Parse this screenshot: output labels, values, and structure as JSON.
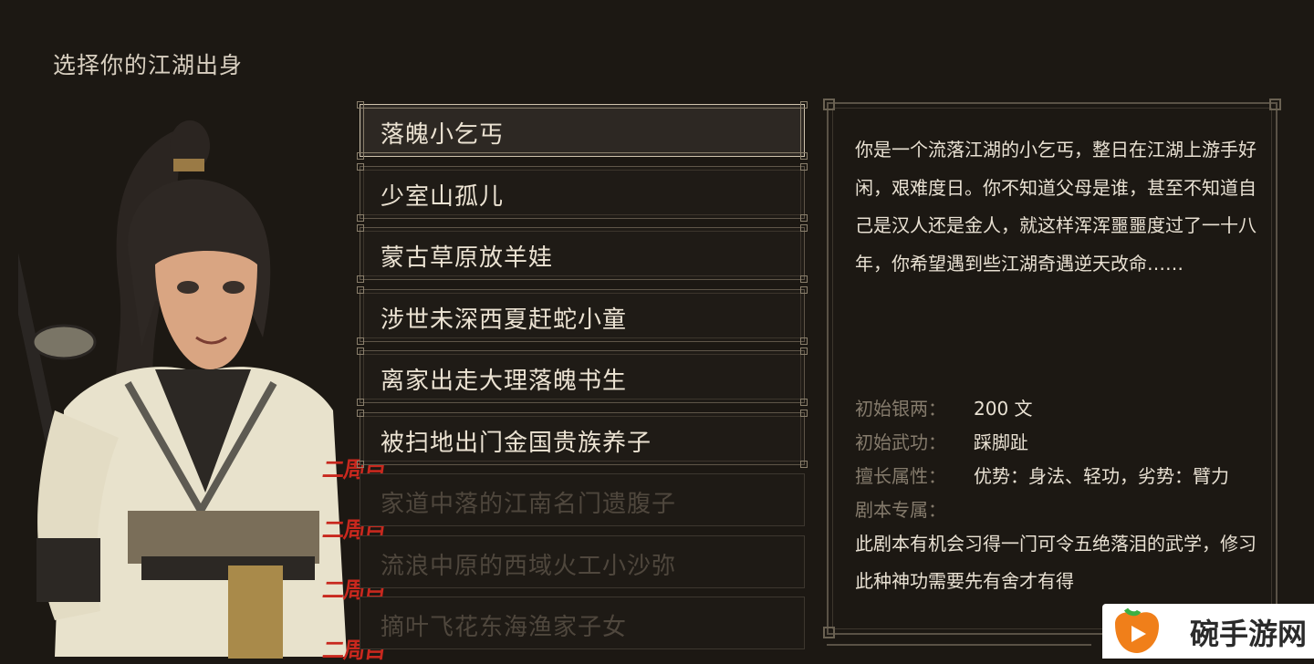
{
  "header": {
    "title": "选择你的江湖出身"
  },
  "origins": [
    {
      "label": "落魄小乞丐",
      "state": "selected"
    },
    {
      "label": "少室山孤儿",
      "state": "normal"
    },
    {
      "label": "蒙古草原放羊娃",
      "state": "normal"
    },
    {
      "label": "涉世未深西夏赶蛇小童",
      "state": "normal"
    },
    {
      "label": "离家出走大理落魄书生",
      "state": "normal"
    },
    {
      "label": "被扫地出门金国贵族养子",
      "state": "normal"
    },
    {
      "label": "家道中落的江南名门遗腹子",
      "state": "locked"
    },
    {
      "label": "流浪中原的西域火工小沙弥",
      "state": "locked"
    },
    {
      "label": "摘叶飞花东海渔家子女",
      "state": "locked"
    }
  ],
  "badges": {
    "second_run": "二周目"
  },
  "detail": {
    "description": "你是一个流落江湖的小乞丐，整日在江湖上游手好闲，艰难度日。你不知道父母是谁，甚至不知道自己是汉人还是金人，就这样浑浑噩噩度过了一十八年，你希望遇到些江湖奇遇逆天改命……",
    "stats": [
      {
        "key": "初始银两：",
        "value": "200 文"
      },
      {
        "key": "初始武功：",
        "value": "踩脚趾"
      },
      {
        "key": "擅长属性：",
        "value": "优势：身法、轻功，劣势：臂力"
      },
      {
        "key": "剧本专属：",
        "value": ""
      }
    ],
    "exclusive_text": "此剧本有机会习得一门可令五绝落泪的武学，修习此种神功需要先有舍才有得"
  },
  "watermark": {
    "text": "碗手游网"
  },
  "colors": {
    "badge": "#c8281e",
    "background": "#1c1813",
    "text": "#e6dccb"
  }
}
